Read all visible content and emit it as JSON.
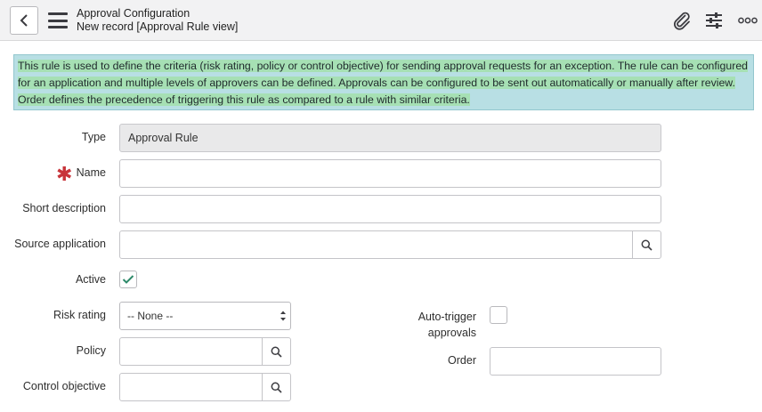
{
  "header": {
    "title": "Approval Configuration",
    "subtitle": "New record [Approval Rule view]",
    "icons": [
      "back-icon",
      "hamburger-menu-icon",
      "paperclip-icon",
      "sliders-icon",
      "more-icon"
    ]
  },
  "banner": {
    "line1": "This rule is used to define the criteria (risk rating, policy or control objective) for sending approval requests for an exception. The rule can be configured",
    "line2": "for an application and multiple levels of approvers can be defined. Approvals can be configured to be sent out automatically or manually after review.",
    "line3": "Order defines the precedence of triggering this rule as compared to a rule with similar criteria."
  },
  "form": {
    "type_label": "Type",
    "type_value": "Approval Rule",
    "name_label": "Name",
    "name_value": "",
    "short_description_label": "Short description",
    "short_description_value": "",
    "source_application_label": "Source application",
    "source_application_value": "",
    "active_label": "Active",
    "active_checked": true,
    "risk_rating_label": "Risk rating",
    "risk_rating_value": "-- None --",
    "policy_label": "Policy",
    "policy_value": "",
    "control_objective_label": "Control objective",
    "control_objective_value": "",
    "auto_trigger_label_1": "Auto-trigger",
    "auto_trigger_label_2": "approvals",
    "auto_trigger_checked": false,
    "order_label": "Order",
    "order_value": ""
  },
  "colors": {
    "banner_bg": "#b8dfe4",
    "highlight": "#a6e0b4",
    "required": "#c8343a",
    "check": "#2e8a6a"
  }
}
